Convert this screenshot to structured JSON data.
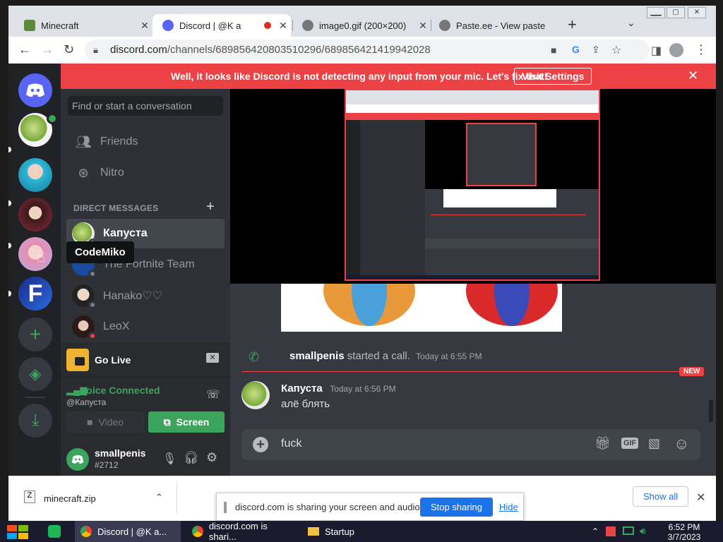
{
  "browser": {
    "tabs": [
      {
        "title": "Minecraft",
        "close": "✕"
      },
      {
        "title": "Discord | @K a",
        "close": "✕"
      },
      {
        "title": "image0.gif (200×200)",
        "close": "✕"
      },
      {
        "title": "Paste.ee - View paste",
        "close": "✕"
      }
    ],
    "new_tab": "+",
    "url_domain": "discord.com",
    "url_path": "/channels/689856420803510296/689856421419942028",
    "window_buttons": [
      "▁▁",
      "▢",
      "✕"
    ]
  },
  "banner": {
    "text": "Well, it looks like Discord is not detecting any input from your mic. Let's fix that!",
    "button": "Visit Settings",
    "close": "✕"
  },
  "sidebar": {
    "search_placeholder": "Find or start a conversation",
    "nav": [
      {
        "label": "Friends",
        "icon": "friends-icon"
      },
      {
        "label": "Nitro",
        "icon": "nitro-icon"
      }
    ],
    "dm_header": "DIRECT MESSAGES",
    "dm_add": "+",
    "dms": [
      {
        "name": "Капуста",
        "status_color": "#3ba55d",
        "selected": true
      },
      {
        "name": "The Fortnite Team",
        "status_color": "#747f8d"
      },
      {
        "name": "Hanako♡♡",
        "status_color": "#747f8d"
      },
      {
        "name": "LeoX",
        "status_color": "#ed4245"
      }
    ],
    "tooltip": "CodeMiko",
    "go_live": "Go Live",
    "voice_connected": "Voice Connected",
    "voice_channel": "@Капуста",
    "video_btn": "Video",
    "screen_btn": "Screen",
    "user": {
      "name": "smallpenis",
      "tag": "#2712"
    }
  },
  "chat": {
    "call_user": "smallpenis",
    "call_text": "started a call.",
    "call_time": "Today at 6:55 PM",
    "new_badge": "NEW",
    "message_user": "Капуста",
    "message_time": "Today at 6:56 PM",
    "message_text": "алё блять",
    "composer_text": "fuck",
    "gif_label": "GIF"
  },
  "downloads": {
    "file": "minecraft.zip",
    "show_all": "Show all",
    "close": "✕"
  },
  "sharebar": {
    "text": "discord.com is sharing your screen and audio.",
    "stop": "Stop sharing",
    "hide": "Hide"
  },
  "taskbar": {
    "items": [
      "Discord | @K a...",
      "discord.com is shari...",
      "Startup"
    ],
    "time": "6:52 PM",
    "date": "3/7/2023"
  },
  "colors": {
    "discord_blurple": "#5865f2",
    "discord_red": "#ed4245",
    "discord_green": "#3ba55d"
  }
}
